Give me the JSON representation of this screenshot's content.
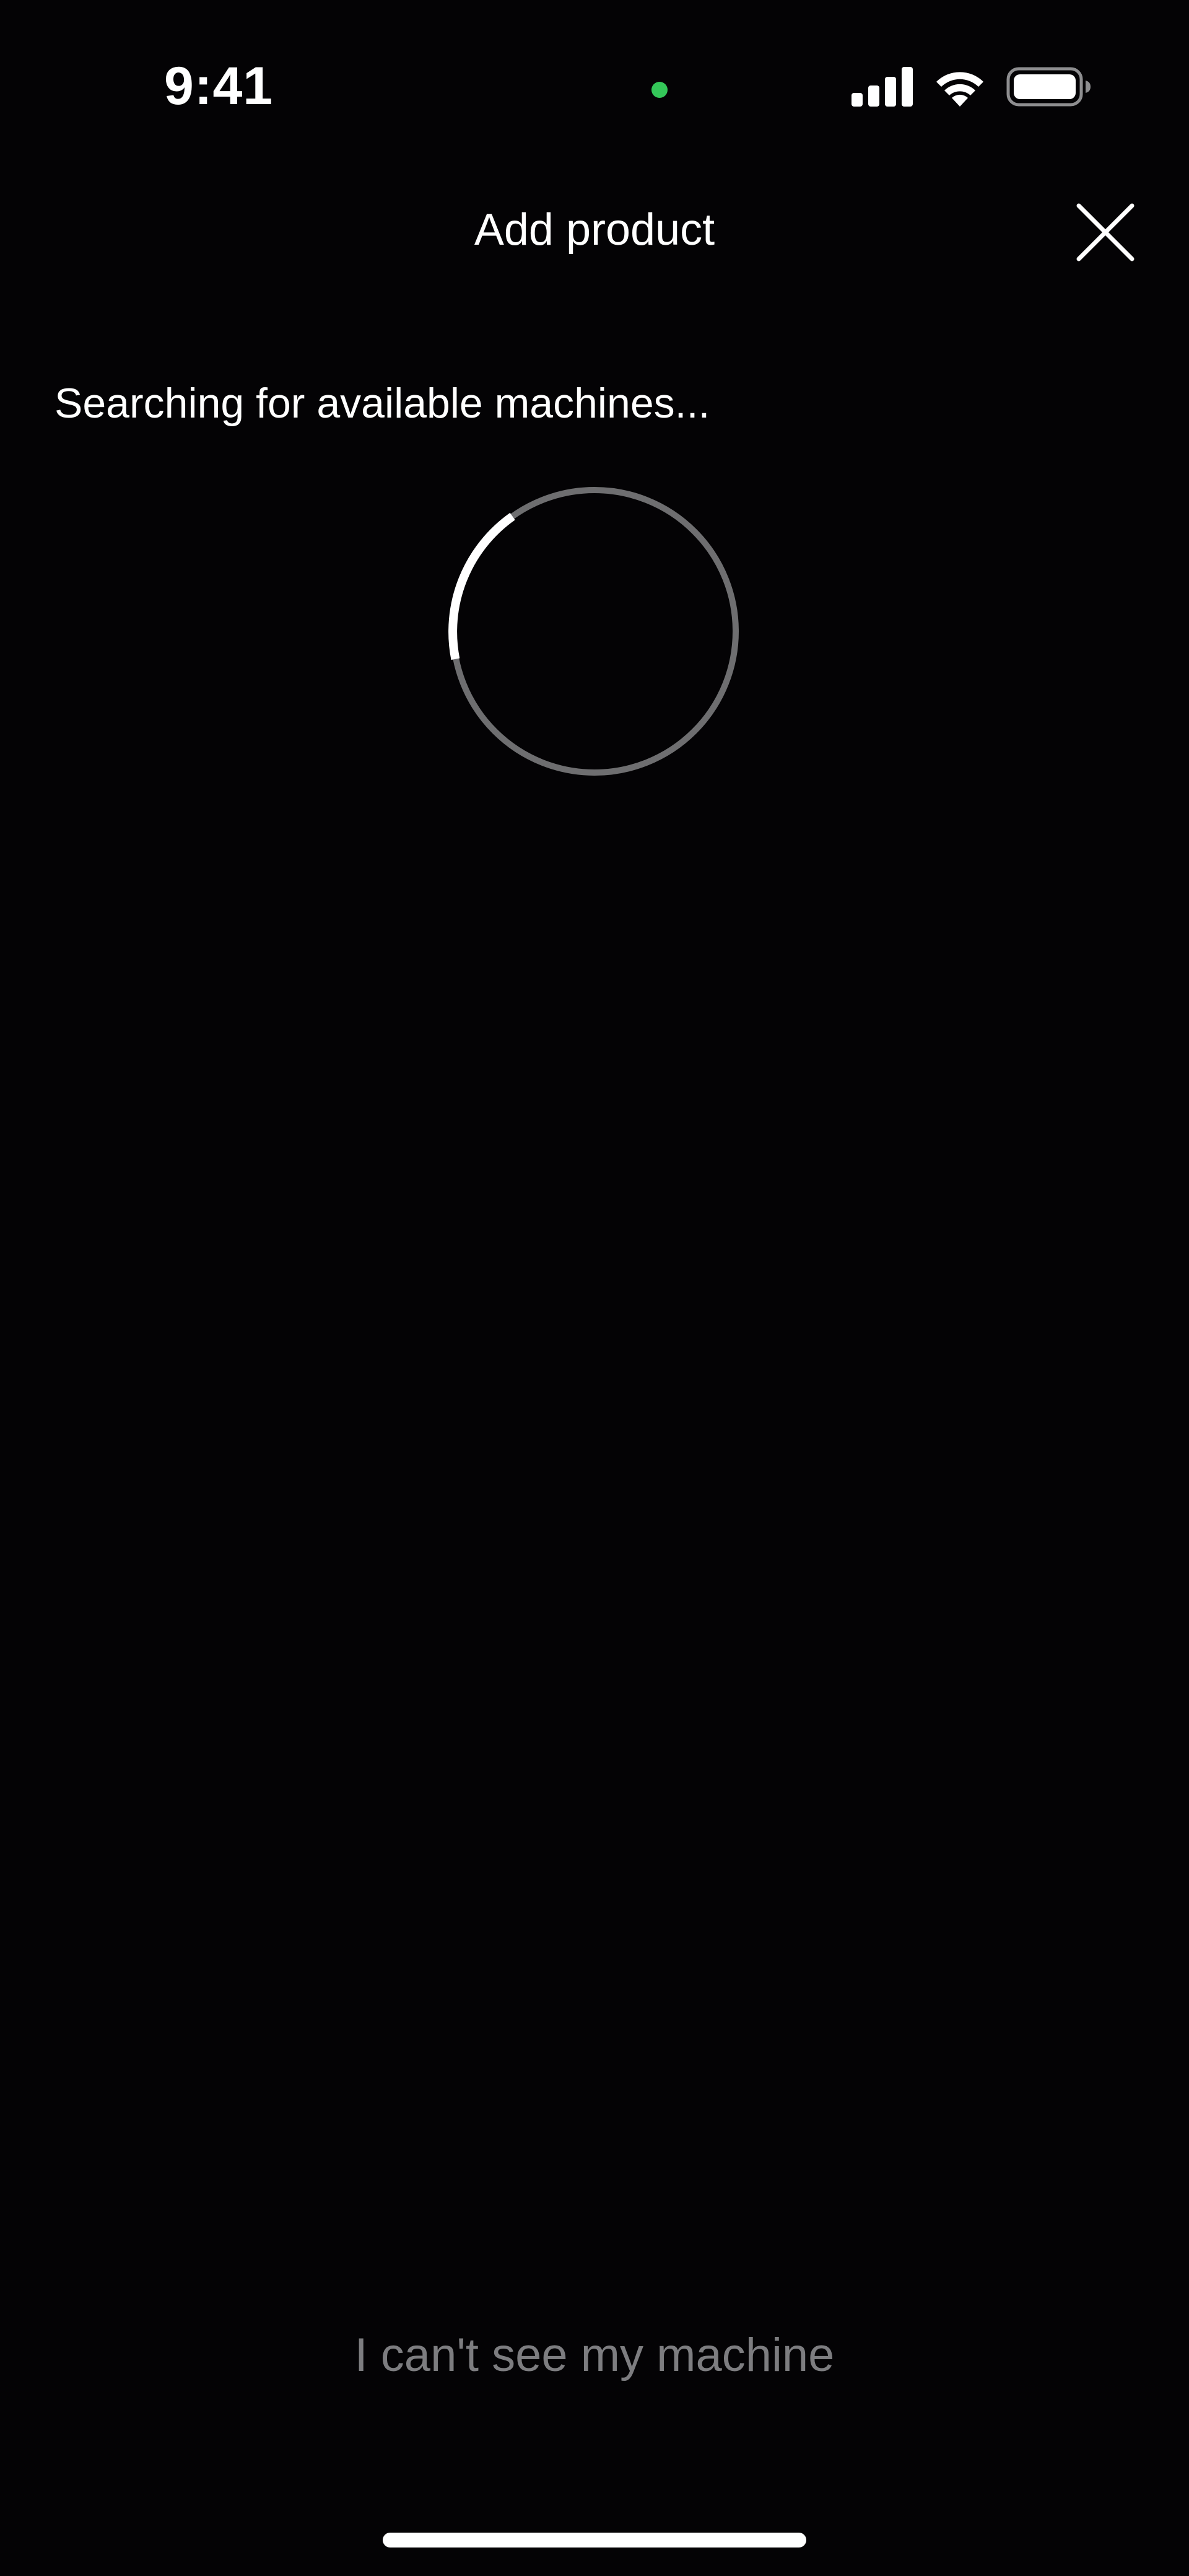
{
  "status_bar": {
    "time": "9:41",
    "privacy_indicator_color": "#34c759",
    "icons": [
      "cellular-signal-icon",
      "wifi-icon",
      "battery-icon"
    ]
  },
  "header": {
    "title": "Add product",
    "close_icon": "close-icon"
  },
  "main": {
    "status_text": "Searching for available machines...",
    "spinner": {
      "icon": "loading-spinner-icon",
      "track_color": "#6e6e70",
      "active_color": "#ffffff"
    }
  },
  "footer": {
    "help_link": "I can't see my machine",
    "help_link_color": "#7d7d80"
  },
  "colors": {
    "background": "#040305",
    "text": "#ffffff"
  }
}
